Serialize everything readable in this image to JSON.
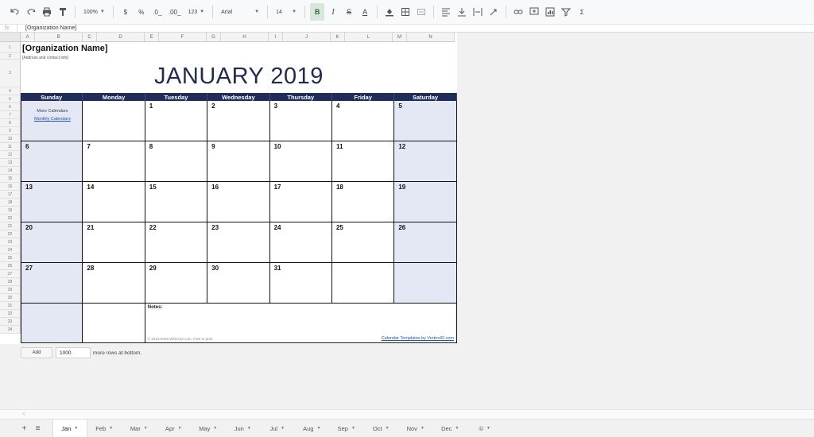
{
  "toolbar": {
    "zoom": "100%",
    "currency": "$",
    "percent": "%",
    "dec_decrease": ".0_",
    "dec_increase": ".00_",
    "more_formats": "123",
    "font": "Arial",
    "font_size": "14",
    "bold": "B",
    "italic": "I",
    "strike": "S",
    "text_color": "A",
    "sum": "Σ"
  },
  "formula_bar": {
    "fx": "fx",
    "value": "[Organization Name]"
  },
  "columns": [
    "A",
    "B",
    "C",
    "D",
    "E",
    "F",
    "G",
    "H",
    "I",
    "J",
    "K",
    "L",
    "M",
    "N"
  ],
  "rows": [
    "1",
    "2",
    "3",
    "4",
    "5",
    "6",
    "7",
    "8",
    "9",
    "10",
    "11",
    "12",
    "13",
    "14",
    "15",
    "16",
    "17",
    "18",
    "19",
    "20",
    "21",
    "22",
    "23",
    "24",
    "25",
    "26",
    "27",
    "28",
    "29",
    "30",
    "31",
    "32",
    "33",
    "34"
  ],
  "calendar": {
    "org_name": "[Organization Name]",
    "org_sub": "[Address and contact info]",
    "title": "JANUARY 2019",
    "days_of_week": [
      "Sunday",
      "Monday",
      "Tuesday",
      "Wednesday",
      "Thursday",
      "Friday",
      "Saturday"
    ],
    "more_calendars": "More Calendars",
    "monthly_calendars": "Monthly Calendars",
    "weeks": [
      [
        "",
        "",
        "1",
        "2",
        "3",
        "4",
        "5"
      ],
      [
        "6",
        "7",
        "8",
        "9",
        "10",
        "11",
        "12"
      ],
      [
        "13",
        "14",
        "15",
        "16",
        "17",
        "18",
        "19"
      ],
      [
        "20",
        "21",
        "22",
        "23",
        "24",
        "25",
        "26"
      ],
      [
        "27",
        "28",
        "29",
        "30",
        "31",
        "",
        ""
      ]
    ],
    "notes_label": "Notes:",
    "copyright": "© 2013-2019 Vertex42.com. Free to print.",
    "templates_link": "Calendar Templates by Vertex42.com"
  },
  "add_rows": {
    "button": "Add",
    "count": "1000",
    "suffix": "more rows at bottom."
  },
  "sheet_tabs": {
    "add": "+",
    "all_sheets": "≡",
    "tabs": [
      "Jan",
      "Feb",
      "Mar",
      "Apr",
      "May",
      "Jun",
      "Jul",
      "Aug",
      "Sep",
      "Oct",
      "Nov",
      "Dec",
      "©"
    ],
    "active": "Jan"
  },
  "colors": {
    "header_navy": "#1f2d5c",
    "title_navy": "#1f2a57",
    "weekend_fill": "#e4e7f4",
    "link_blue": "#1a4fd3"
  }
}
